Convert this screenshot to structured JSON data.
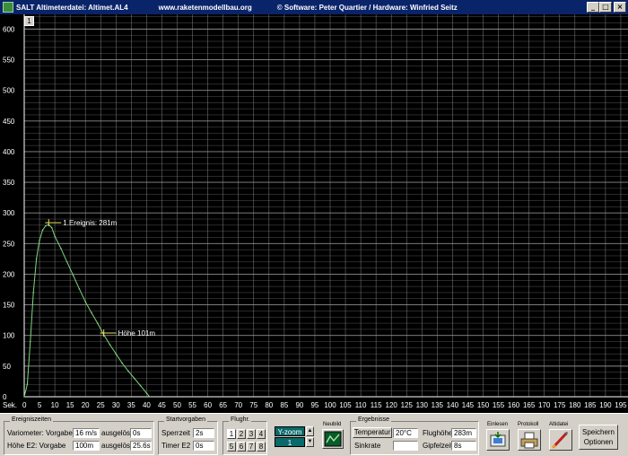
{
  "window": {
    "title_app": "SALT Altimeterdatei: Altimet.AL4",
    "title_url": "www.raketenmodellbau.org",
    "title_credit": "© Software: Peter Quartier / Hardware: Winfried Seitz",
    "minimize": "_",
    "maximize": "□",
    "close": "×"
  },
  "plot": {
    "graph_tab": "1",
    "x_unit": "Sek.",
    "background": "#000000",
    "grid_color": "#9a9a9a",
    "curve_color": "#7fd67f",
    "label_color": "#ffffff",
    "events": [
      {
        "text": "1.Ereignis: 281m",
        "x": 8,
        "y": 281
      },
      {
        "text": "Höhe  101m",
        "x": 26,
        "y": 101
      }
    ]
  },
  "chart_data": {
    "type": "line",
    "x_ticks": [
      0,
      5,
      10,
      15,
      20,
      25,
      30,
      35,
      40,
      45,
      50,
      55,
      60,
      65,
      70,
      75,
      80,
      85,
      90,
      95,
      100,
      105,
      110,
      115,
      120,
      125,
      130,
      135,
      140,
      145,
      150,
      155,
      160,
      165,
      170,
      175,
      180,
      185,
      190,
      195
    ],
    "y_ticks": [
      0,
      50,
      100,
      150,
      200,
      250,
      300,
      350,
      400,
      450,
      500,
      550,
      600
    ],
    "xlim": [
      0,
      195
    ],
    "ylim": [
      0,
      600
    ],
    "series": [
      {
        "x": [
          0,
          1,
          2,
          3,
          4,
          5,
          6,
          7,
          8,
          9,
          10,
          12,
          14,
          16,
          18,
          20,
          22,
          24,
          26,
          28,
          30,
          32,
          34,
          36,
          38,
          40,
          41
        ],
        "y": [
          0,
          20,
          90,
          170,
          225,
          255,
          272,
          279,
          281,
          276,
          262,
          242,
          220,
          198,
          176,
          155,
          137,
          120,
          101,
          85,
          70,
          55,
          42,
          30,
          18,
          6,
          0
        ]
      }
    ]
  },
  "ereigniszeiten": {
    "title": "Ereigniszeiten",
    "row1_label": "Variometer:  Vorgabe",
    "row1_value": "16 m/s",
    "row1_status_label": "ausgelöst",
    "row1_status_value": "0s",
    "row2_label": "Höhe E2:      Vorgabe",
    "row2_value": "100m",
    "row2_status_label": "ausgelöst",
    "row2_status_value": "25.6s"
  },
  "startvorgaben": {
    "title": "Startvorgaben",
    "sperrzeit_label": "Sperrzeit",
    "sperrzeit_value": "2s",
    "timer_label": "Timer E2",
    "timer_value": "0s"
  },
  "flughr": {
    "title": "Flughr.",
    "buttons": [
      "1",
      "2",
      "3",
      "4",
      "5",
      "6",
      "7",
      "8"
    ]
  },
  "zoom": {
    "label": "Y-zoom",
    "value": "1",
    "up": "▲",
    "down": "▼"
  },
  "neubild": {
    "title": "Neubild"
  },
  "ergebnisse": {
    "title": "Ergebnisse",
    "temp_button": "Temperatur",
    "temp_value": "20°C",
    "sinkrate_label": "Sinkrate",
    "sinkrate_value": "",
    "flughoehe_label": "Flughöhe",
    "flughoehe_value": "283m",
    "gipfelzeit_label": "Gipfelzeit",
    "gipfelzeit_value": "8s"
  },
  "actions": {
    "einlesen": "Einlesen",
    "protokoll": "Protokoll",
    "altidatei": "Altidatei",
    "speichern": "Speichern",
    "optionen": "Optionen"
  }
}
